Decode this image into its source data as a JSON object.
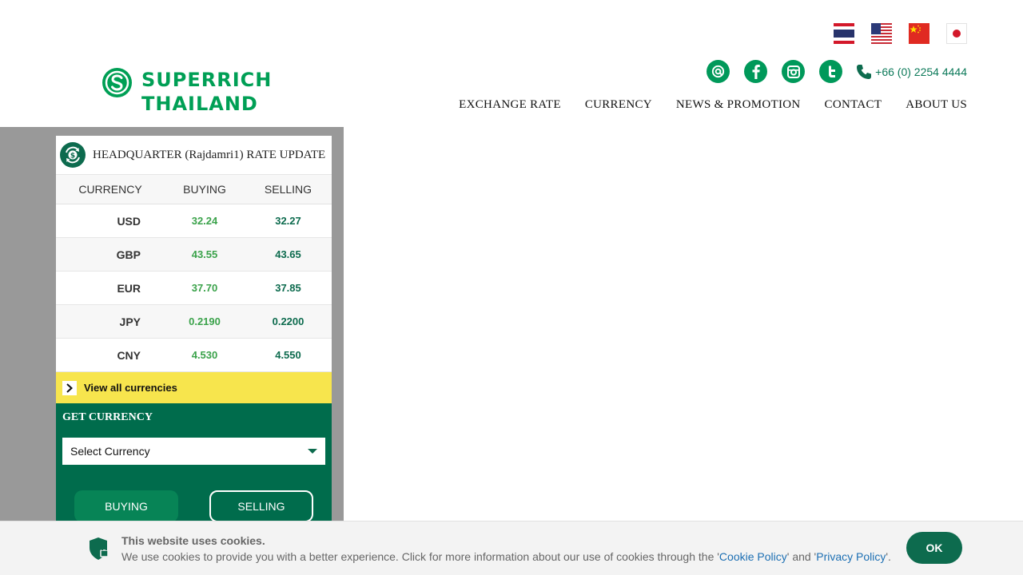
{
  "brand": {
    "line1": "SUPERRICH",
    "line2": "THAILAND",
    "color": "#009f55"
  },
  "flags": [
    {
      "name": "thailand-flag-icon"
    },
    {
      "name": "usa-flag-icon"
    },
    {
      "name": "china-flag-icon"
    },
    {
      "name": "japan-flag-icon"
    }
  ],
  "contact": {
    "phone": "+66 (0) 2254 4444"
  },
  "nav": {
    "exchange_rate": "EXCHANGE RATE",
    "currency": "CURRENCY",
    "news": "NEWS & PROMOTION",
    "contact": "CONTACT",
    "about": "ABOUT US"
  },
  "rates": {
    "title": "HEADQUARTER (Rajdamri1) RATE UPDATE",
    "headers": {
      "currency": "CURRENCY",
      "buying": "BUYING",
      "selling": "SELLING"
    },
    "rows": [
      {
        "currency": "USD",
        "buying": "32.24",
        "selling": "32.27"
      },
      {
        "currency": "GBP",
        "buying": "43.55",
        "selling": "43.65"
      },
      {
        "currency": "EUR",
        "buying": "37.70",
        "selling": "37.85"
      },
      {
        "currency": "JPY",
        "buying": "0.2190",
        "selling": "0.2200"
      },
      {
        "currency": "CNY",
        "buying": "4.530",
        "selling": "4.550"
      }
    ],
    "view_all": "View all currencies"
  },
  "get_currency": {
    "title": "GET CURRENCY",
    "select_value": "Select Currency",
    "buying": "BUYING",
    "selling": "SELLING"
  },
  "cookie": {
    "title": "This website uses cookies.",
    "text_before": "We use cookies to provide you with a better experience. Click for more information about our use of cookies through the '",
    "cookie_policy": "Cookie Policy",
    "text_mid": "' and '",
    "privacy_policy": "Privacy Policy",
    "text_end": "'.",
    "ok": "OK"
  },
  "colors": {
    "green": "#006c4c",
    "accent_green": "#00995a",
    "yellow": "#f7e54d",
    "sidebar_grey": "#999999"
  }
}
